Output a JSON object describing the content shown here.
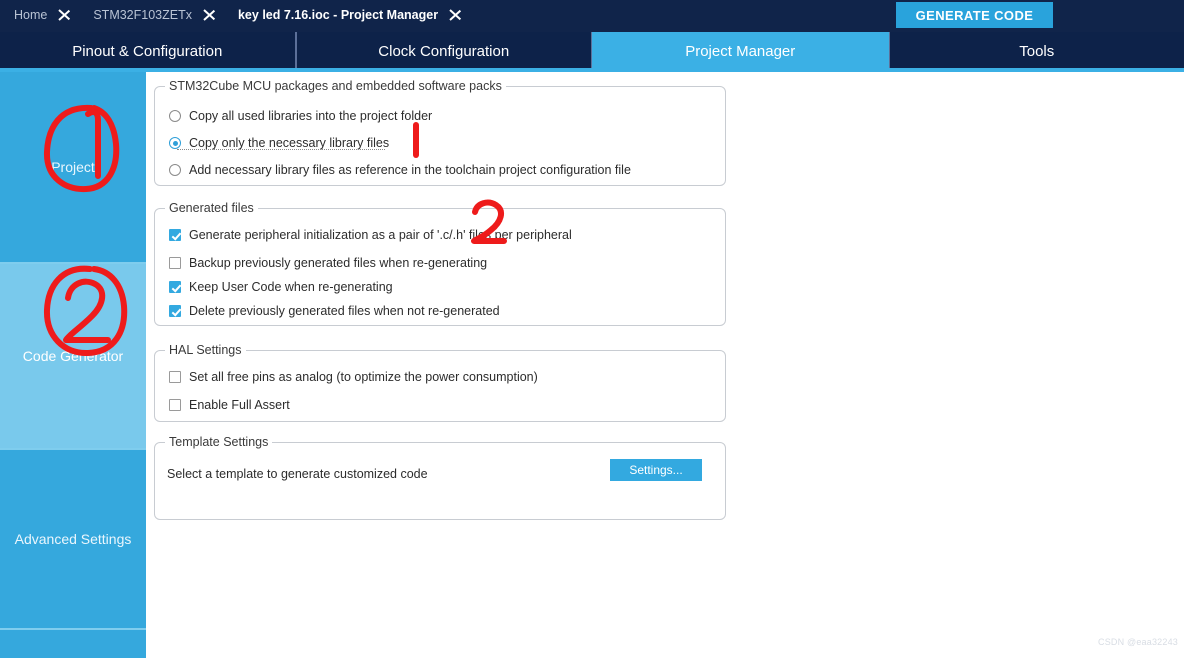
{
  "breadcrumb": {
    "items": [
      {
        "label": "Home",
        "active": false
      },
      {
        "label": "STM32F103ZETx",
        "active": false
      },
      {
        "label": "key led 7.16.ioc - Project Manager",
        "active": true
      }
    ]
  },
  "header": {
    "generate_code_label": "GENERATE CODE"
  },
  "tabs": [
    {
      "label": "Pinout & Configuration",
      "selected": false
    },
    {
      "label": "Clock Configuration",
      "selected": false
    },
    {
      "label": "Project Manager",
      "selected": true
    },
    {
      "label": "Tools",
      "selected": false
    }
  ],
  "sidebar": {
    "items": [
      {
        "label": "Project",
        "selected": false
      },
      {
        "label": "Code Generator",
        "selected": true
      },
      {
        "label": "Advanced Settings",
        "selected": false
      },
      {
        "label": "",
        "selected": false
      }
    ]
  },
  "groups": {
    "mcu_packages": {
      "title": "STM32Cube MCU packages and embedded software packs",
      "options": [
        {
          "label": "Copy all used libraries into the project folder",
          "checked": false
        },
        {
          "label": "Copy only the necessary library files",
          "checked": true
        },
        {
          "label": "Add necessary library files as reference in the toolchain project configuration file",
          "checked": false
        }
      ]
    },
    "generated_files": {
      "title": "Generated files",
      "options": [
        {
          "label": "Generate peripheral initialization as a pair of '.c/.h' files per peripheral",
          "checked": true
        },
        {
          "label": "Backup previously generated files when re-generating",
          "checked": false
        },
        {
          "label": "Keep User Code when re-generating",
          "checked": true
        },
        {
          "label": "Delete previously generated files when not re-generated",
          "checked": true
        }
      ]
    },
    "hal_settings": {
      "title": "HAL Settings",
      "options": [
        {
          "label": "Set all free pins as analog (to optimize the power consumption)",
          "checked": false
        },
        {
          "label": "Enable Full Assert",
          "checked": false
        }
      ]
    },
    "template_settings": {
      "title": "Template Settings",
      "description": "Select a template to generate customized code",
      "button_label": "Settings..."
    }
  },
  "annotations": {
    "color": "#ee1b1b",
    "marks": [
      {
        "name": "circled-one-over-project",
        "text": "1"
      },
      {
        "name": "circled-two-over-code-generator",
        "text": "2"
      },
      {
        "name": "stroke-one-near-copy-only",
        "text": "1"
      },
      {
        "name": "stroke-two-near-generate-peripheral",
        "text": "2"
      }
    ]
  },
  "watermark": {
    "text": "CSDN @eaa32243"
  }
}
